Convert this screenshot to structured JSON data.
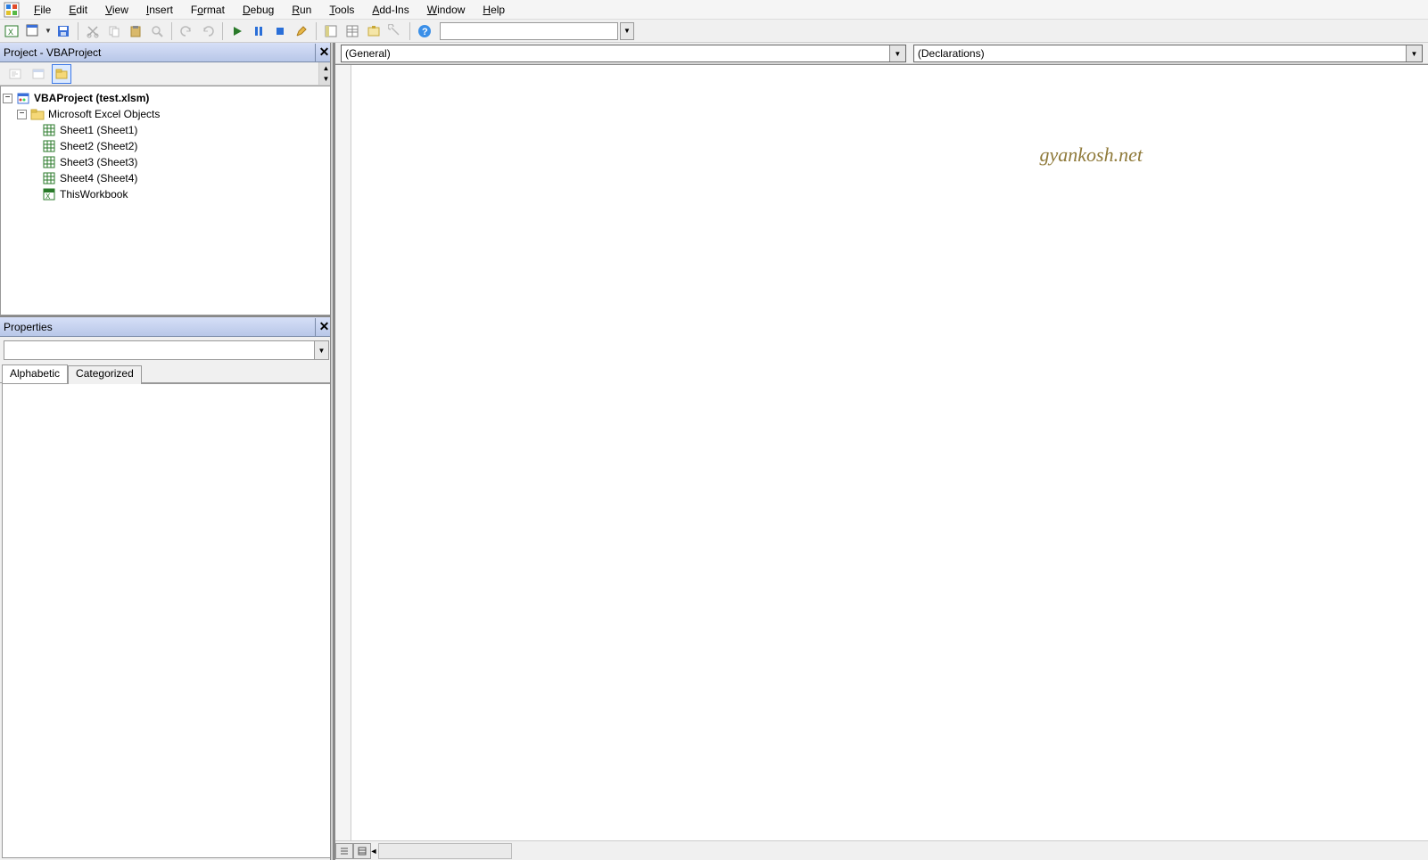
{
  "menu": {
    "items": [
      {
        "key": "F",
        "label": "File"
      },
      {
        "key": "E",
        "label": "Edit"
      },
      {
        "key": "V",
        "label": "View"
      },
      {
        "key": "I",
        "label": "Insert"
      },
      {
        "key": "o",
        "label": "Format"
      },
      {
        "key": "D",
        "label": "Debug"
      },
      {
        "key": "R",
        "label": "Run"
      },
      {
        "key": "T",
        "label": "Tools"
      },
      {
        "key": "A",
        "label": "Add-Ins"
      },
      {
        "key": "W",
        "label": "Window"
      },
      {
        "key": "H",
        "label": "Help"
      }
    ]
  },
  "project_panel": {
    "title": "Project - VBAProject",
    "root_label": "VBAProject (test.xlsm)",
    "folder_label": "Microsoft Excel Objects",
    "items": [
      "Sheet1 (Sheet1)",
      "Sheet2 (Sheet2)",
      "Sheet3 (Sheet3)",
      "Sheet4 (Sheet4)",
      "ThisWorkbook"
    ]
  },
  "properties_panel": {
    "title": "Properties",
    "tabs": {
      "alphabetic": "Alphabetic",
      "categorized": "Categorized"
    }
  },
  "code": {
    "object_combo": "(General)",
    "proc_combo": "(Declarations)"
  },
  "watermark": "gyankosh.net"
}
